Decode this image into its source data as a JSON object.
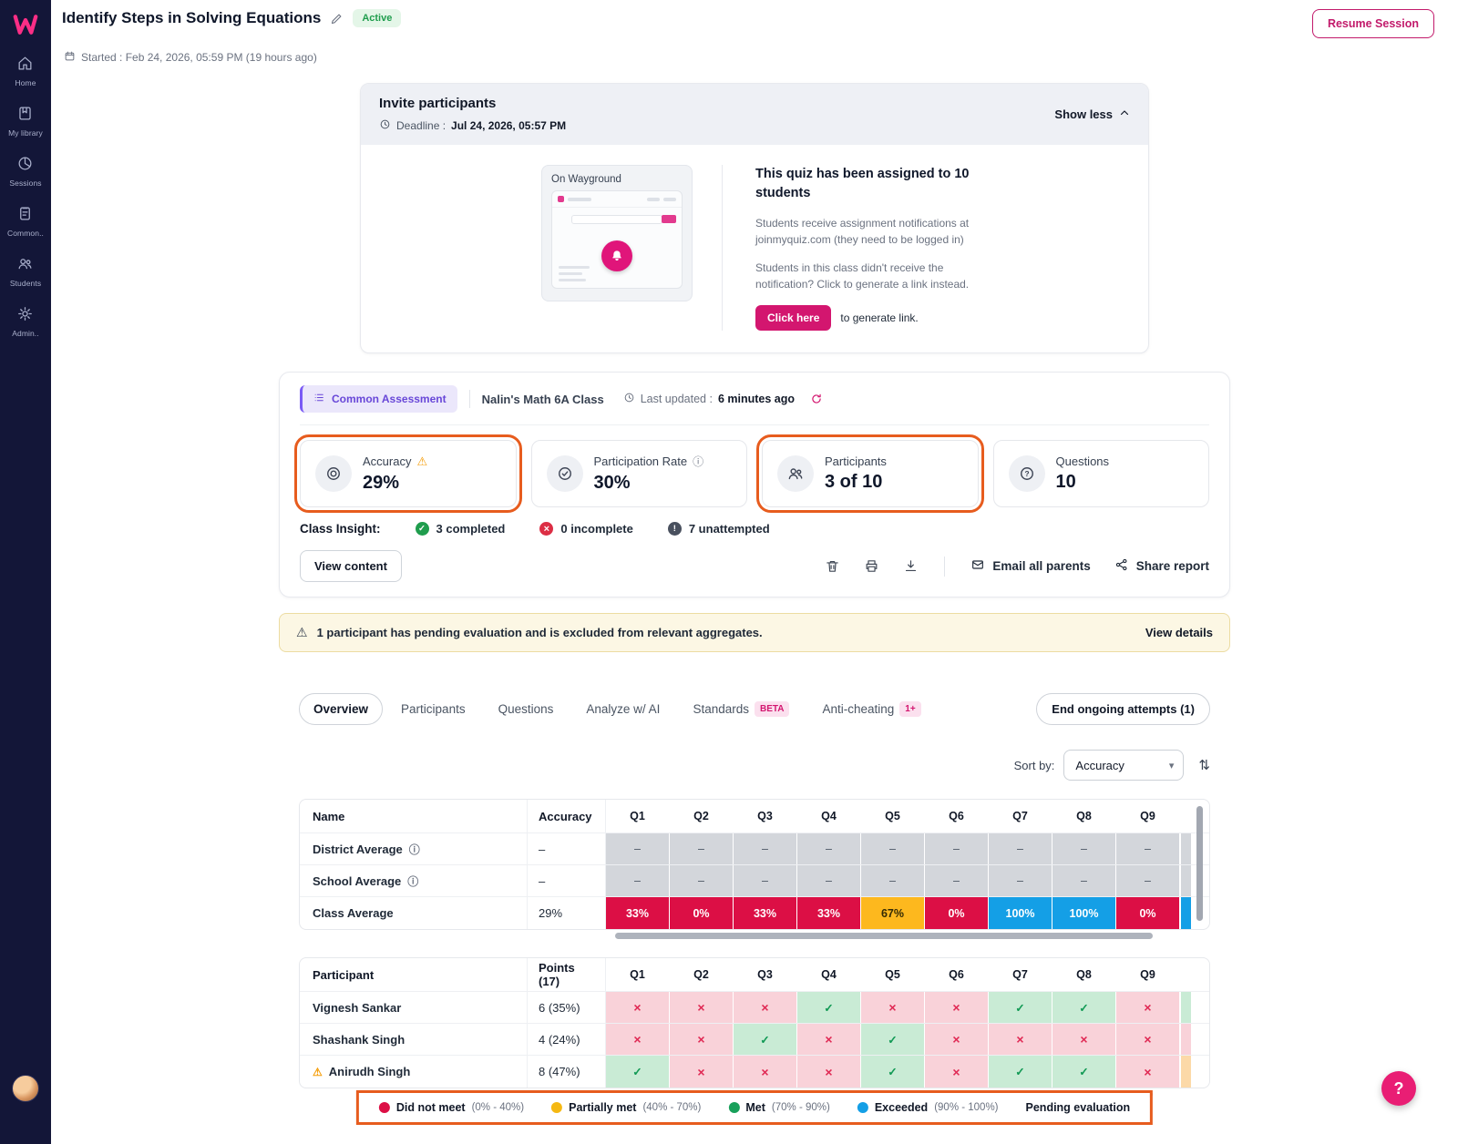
{
  "palette": {
    "accent_pink": "#d3166f",
    "sidebar_bg": "#131638",
    "annotation_orange": "#e75c1e",
    "cell_red": "#dc0f45",
    "cell_yellow": "#fdb81e",
    "cell_blue": "#149fe6",
    "cell_gray": "#d3d6db",
    "correct_bg": "#c9ebd5",
    "wrong_bg": "#f9d2d9",
    "pending_bg": "#fcd9a8"
  },
  "icons": {
    "warning": "⚠",
    "info": "ⓘ",
    "chevron_down": "▾",
    "sort": "⇅",
    "help": "?"
  },
  "sidebar": {
    "items": [
      {
        "label": "Home"
      },
      {
        "label": "My library"
      },
      {
        "label": "Sessions"
      },
      {
        "label": "Common.."
      },
      {
        "label": "Students"
      },
      {
        "label": "Admin.."
      }
    ]
  },
  "header": {
    "title": "Identify Steps in Solving Equations",
    "status": "Active",
    "started": "Started : Feb 24, 2026, 05:59 PM (19 hours ago)",
    "resume_button": "Resume Session"
  },
  "invite": {
    "title": "Invite participants",
    "deadline_label": "Deadline :",
    "deadline_value": "Jul 24, 2026, 05:57 PM",
    "collapse_label": "Show less",
    "preview_caption": "On Wayground",
    "assigned_text": "This quiz has been assigned to 10 students",
    "note1": "Students receive assignment notifications at joinmyquiz.com (they need to be logged in)",
    "note2": "Students in this class didn't receive the notification? Click to generate a link instead.",
    "generate_button": "Click here",
    "generate_suffix": "to generate link."
  },
  "assessment": {
    "type_badge": "Common Assessment",
    "class_name": "Nalin's Math 6A Class",
    "last_updated_label": "Last updated :",
    "last_updated_value": "6 minutes ago",
    "stats": [
      {
        "label": "Accuracy",
        "value": "29%"
      },
      {
        "label": "Participation Rate",
        "value": "30%"
      },
      {
        "label": "Participants",
        "value": "3 of 10"
      },
      {
        "label": "Questions",
        "value": "10"
      }
    ],
    "insight_label": "Class Insight:",
    "insights": [
      {
        "text": "3 completed"
      },
      {
        "text": "0 incomplete"
      },
      {
        "text": "7 unattempted"
      }
    ],
    "view_content_button": "View content",
    "email_parents_button": "Email all parents",
    "share_report_button": "Share report"
  },
  "banner": {
    "text": "1 participant has pending evaluation and is excluded from relevant aggregates.",
    "action": "View details"
  },
  "tabs": {
    "items": [
      {
        "label": "Overview"
      },
      {
        "label": "Participants"
      },
      {
        "label": "Questions"
      },
      {
        "label": "Analyze w/ AI"
      },
      {
        "label": "Standards",
        "badge": "BETA"
      },
      {
        "label": "Anti-cheating",
        "badge": "1+"
      }
    ],
    "end_attempts_button": "End ongoing attempts (1)"
  },
  "sort": {
    "label": "Sort by:",
    "selected": "Accuracy"
  },
  "averages_table": {
    "name_header": "Name",
    "accuracy_header": "Accuracy",
    "question_headers": [
      "Q1",
      "Q2",
      "Q3",
      "Q4",
      "Q5",
      "Q6",
      "Q7",
      "Q8",
      "Q9"
    ],
    "rows": [
      {
        "name": "District Average",
        "accuracy": "–",
        "clipped": "gray",
        "cells": [
          {
            "text": "–",
            "tone": "gray"
          },
          {
            "text": "–",
            "tone": "gray"
          },
          {
            "text": "–",
            "tone": "gray"
          },
          {
            "text": "–",
            "tone": "gray"
          },
          {
            "text": "–",
            "tone": "gray"
          },
          {
            "text": "–",
            "tone": "gray"
          },
          {
            "text": "–",
            "tone": "gray"
          },
          {
            "text": "–",
            "tone": "gray"
          },
          {
            "text": "–",
            "tone": "gray"
          }
        ]
      },
      {
        "name": "School Average",
        "accuracy": "–",
        "clipped": "gray",
        "cells": [
          {
            "text": "–",
            "tone": "gray"
          },
          {
            "text": "–",
            "tone": "gray"
          },
          {
            "text": "–",
            "tone": "gray"
          },
          {
            "text": "–",
            "tone": "gray"
          },
          {
            "text": "–",
            "tone": "gray"
          },
          {
            "text": "–",
            "tone": "gray"
          },
          {
            "text": "–",
            "tone": "gray"
          },
          {
            "text": "–",
            "tone": "gray"
          },
          {
            "text": "–",
            "tone": "gray"
          }
        ]
      },
      {
        "name": "Class Average",
        "accuracy": "29%",
        "clipped": "blue",
        "cells": [
          {
            "text": "33%",
            "tone": "red"
          },
          {
            "text": "0%",
            "tone": "red"
          },
          {
            "text": "33%",
            "tone": "red"
          },
          {
            "text": "33%",
            "tone": "red"
          },
          {
            "text": "67%",
            "tone": "yellow"
          },
          {
            "text": "0%",
            "tone": "red"
          },
          {
            "text": "100%",
            "tone": "blue"
          },
          {
            "text": "100%",
            "tone": "blue"
          },
          {
            "text": "0%",
            "tone": "red"
          }
        ]
      }
    ]
  },
  "participants_table": {
    "name_header": "Participant",
    "points_header": "Points (17)",
    "question_headers": [
      "Q1",
      "Q2",
      "Q3",
      "Q4",
      "Q5",
      "Q6",
      "Q7",
      "Q8",
      "Q9"
    ],
    "rows": [
      {
        "name": "Vignesh Sankar",
        "points": "6 (35%)",
        "clipped": "green",
        "marks": [
          "x",
          "x",
          "x",
          "check",
          "x",
          "x",
          "check",
          "check",
          "x"
        ]
      },
      {
        "name": "Shashank Singh",
        "points": "4 (24%)",
        "clipped": "pink",
        "marks": [
          "x",
          "x",
          "check",
          "x",
          "check",
          "x",
          "x",
          "x",
          "x"
        ]
      },
      {
        "name": "Anirudh Singh",
        "points": "8 (47%)",
        "warning": true,
        "clipped": "orange",
        "marks": [
          "check",
          "x",
          "x",
          "x",
          "check",
          "x",
          "check",
          "check",
          "x"
        ]
      }
    ]
  },
  "legend": {
    "items": [
      {
        "label": "Did not meet",
        "range": "(0% - 40%)",
        "color": "#dc0f45"
      },
      {
        "label": "Partially met",
        "range": "(40% - 70%)",
        "color": "#f5b812"
      },
      {
        "label": "Met",
        "range": "(70% - 90%)",
        "color": "#18a05a"
      },
      {
        "label": "Exceeded",
        "range": "(90% - 100%)",
        "color": "#149fe6"
      },
      {
        "label": "Pending evaluation",
        "range": "",
        "color": ""
      }
    ]
  }
}
